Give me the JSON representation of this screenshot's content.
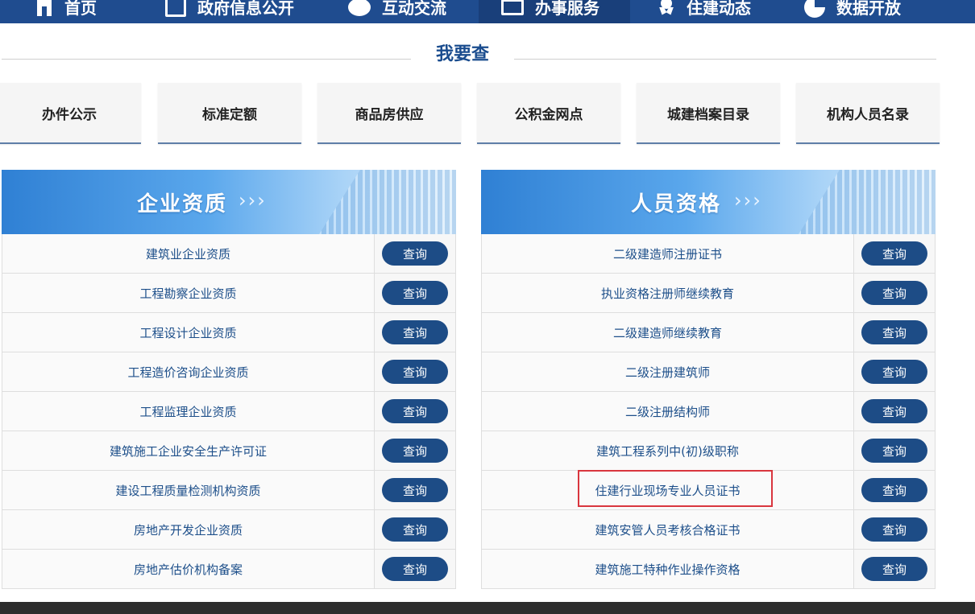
{
  "nav": {
    "items": [
      {
        "label": "首页",
        "icon": "home-icon"
      },
      {
        "label": "政府信息公开",
        "icon": "document-icon"
      },
      {
        "label": "互动交流",
        "icon": "chat-icon"
      },
      {
        "label": "办事服务",
        "icon": "monitor-icon",
        "active": true
      },
      {
        "label": "住建动态",
        "icon": "award-icon"
      },
      {
        "label": "数据开放",
        "icon": "pie-chart-icon"
      }
    ]
  },
  "section": {
    "title": "我要查"
  },
  "quick_links": [
    "办件公示",
    "标准定额",
    "商品房供应",
    "公积金网点",
    "城建档案目录",
    "机构人员名录"
  ],
  "panels": {
    "enterprise": {
      "title": "企业资质",
      "arrows": "›››",
      "items": [
        "建筑业企业资质",
        "工程勘察企业资质",
        "工程设计企业资质",
        "工程造价咨询企业资质",
        "工程监理企业资质",
        "建筑施工企业安全生产许可证",
        "建设工程质量检测机构资质",
        "房地产开发企业资质",
        "房地产估价机构备案"
      ],
      "button_label": "查询"
    },
    "personnel": {
      "title": "人员资格",
      "arrows": "›››",
      "items": [
        "二级建造师注册证书",
        "执业资格注册师继续教育",
        "二级建造师继续教育",
        "二级注册建筑师",
        "二级注册结构师",
        "建筑工程系列中(初)级职称",
        "住建行业现场专业人员证书",
        "建筑安管人员考核合格证书",
        "建筑施工特种作业操作资格"
      ],
      "button_label": "查询"
    }
  },
  "colors": {
    "nav_bg": "#1f4c8f",
    "accent": "#1d4c86",
    "highlight": "#d9363e"
  }
}
